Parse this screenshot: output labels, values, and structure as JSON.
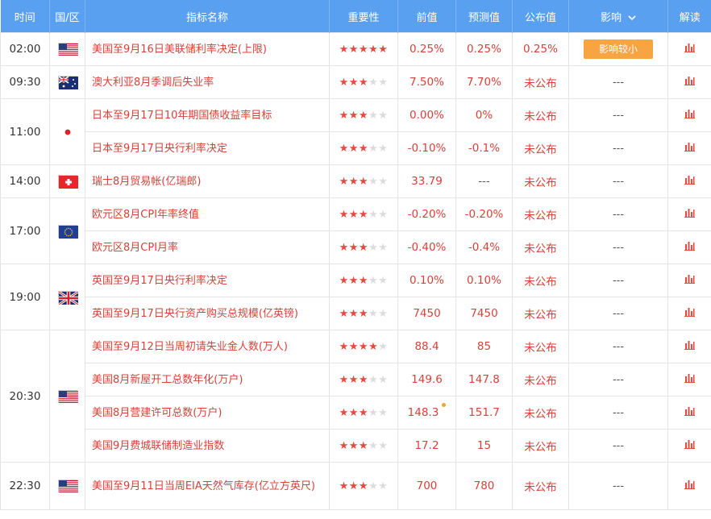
{
  "header": {
    "time": "时间",
    "country": "国/区",
    "indicator": "指标名称",
    "importance": "重要性",
    "previous": "前值",
    "forecast": "预测值",
    "actual": "公布值",
    "impact": "影响",
    "interpret": "解读"
  },
  "times": [
    "02:00",
    "09:30",
    "11:00",
    "14:00",
    "17:00",
    "19:00",
    "20:30",
    "22:30"
  ],
  "rows": [
    {
      "name": "美国至9月16日美联储利率决定(上限)",
      "stars": 5,
      "prev": "0.25%",
      "fcst": "0.25%",
      "actual": "0.25%",
      "impact": "影响较小"
    },
    {
      "name": "澳大利亚8月季调后失业率",
      "stars": 3,
      "prev": "7.50%",
      "fcst": "7.70%",
      "actual": "未公布",
      "impact": "---"
    },
    {
      "name": "日本至9月17日10年期国债收益率目标",
      "stars": 3,
      "prev": "0.00%",
      "fcst": "0%",
      "actual": "未公布",
      "impact": "---"
    },
    {
      "name": "日本至9月17日央行利率决定",
      "stars": 3,
      "prev": "-0.10%",
      "fcst": "-0.1%",
      "actual": "未公布",
      "impact": "---"
    },
    {
      "name": "瑞士8月贸易帐(亿瑞郎)",
      "stars": 3,
      "prev": "33.79",
      "fcst": "---",
      "actual": "未公布",
      "impact": "---"
    },
    {
      "name": "欧元区8月CPI年率终值",
      "stars": 3,
      "prev": "-0.20%",
      "fcst": "-0.20%",
      "actual": "未公布",
      "impact": "---"
    },
    {
      "name": "欧元区8月CPI月率",
      "stars": 3,
      "prev": "-0.40%",
      "fcst": "-0.4%",
      "actual": "未公布",
      "impact": "---"
    },
    {
      "name": "英国至9月17日央行利率决定",
      "stars": 3,
      "prev": "0.10%",
      "fcst": "0.10%",
      "actual": "未公布",
      "impact": "---"
    },
    {
      "name": "英国至9月17日央行资产购买总规模(亿英镑)",
      "stars": 3,
      "prev": "7450",
      "fcst": "7450",
      "actual": "未公布",
      "impact": "---"
    },
    {
      "name": "美国至9月12日当周初请失业金人数(万人)",
      "stars": 4,
      "prev": "88.4",
      "fcst": "85",
      "actual": "未公布",
      "impact": "---"
    },
    {
      "name": "美国8月新屋开工总数年化(万户)",
      "stars": 3,
      "prev": "149.6",
      "fcst": "147.8",
      "actual": "未公布",
      "impact": "---"
    },
    {
      "name": "美国8月营建许可总数(万户)",
      "stars": 3,
      "prev": "148.3",
      "fcst": "151.7",
      "actual": "未公布",
      "impact": "---"
    },
    {
      "name": "美国9月费城联储制造业指数",
      "stars": 3,
      "prev": "17.2",
      "fcst": "15",
      "actual": "未公布",
      "impact": "---"
    },
    {
      "name": "美国至9月11日当周EIA天然气库存(亿立方英尺)",
      "stars": 3,
      "prev": "700",
      "fcst": "780",
      "actual": "未公布",
      "impact": "---"
    }
  ],
  "colors": {
    "header_bg": "#5aa0f0",
    "accent_red": "#e44a3f",
    "impact_btn": "#f7a442"
  }
}
